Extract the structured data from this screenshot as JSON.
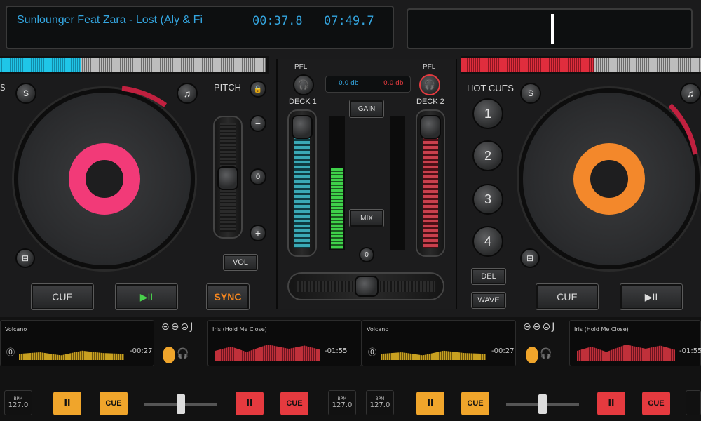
{
  "deckA": {
    "track_title": "Sunlounger Feat Zara - Lost (Aly & Fi",
    "elapsed": "00:37.8",
    "remaining": "07:49.7",
    "pitch_label": "PITCH",
    "s_label": "S",
    "pitch_minus": "−",
    "pitch_zero": "0",
    "pitch_plus": "+",
    "vol_label": "VOL",
    "cue_label": "CUE",
    "play_label": "▶II",
    "sync_label": "SYNC",
    "jog_color": "#f23a78"
  },
  "deckB": {
    "hot_cues_label": "HOT CUES",
    "s_label": "S",
    "hot_cues": [
      "1",
      "2",
      "3",
      "4"
    ],
    "del_label": "DEL",
    "wave_label": "WAVE",
    "cue_label": "CUE",
    "play_label": "▶II",
    "jog_color": "#f3882b"
  },
  "mixer": {
    "pfl_left": "PFL",
    "pfl_right": "PFL",
    "db_left": "0.0 db",
    "db_right": "0.0 db",
    "deck1_label": "DECK 1",
    "deck2_label": "DECK 2",
    "gain_label": "GAIN",
    "mix_label": "MIX",
    "zero_label": "0"
  },
  "bottom": {
    "panels": [
      {
        "track": "Volcano",
        "time": "-00:27"
      },
      {
        "track": "Iris (Hold Me Close)",
        "time": "-01:55"
      },
      {
        "track": "Volcano",
        "time": "-00:27"
      },
      {
        "track": "Iris (Hold Me Close)",
        "time": "-01:55"
      }
    ],
    "bpm_label": "BPM",
    "bpm_value": "127.0",
    "cue_label": "CUE",
    "pause_label": "II"
  },
  "colors": {
    "accent_blue": "#34a6e0",
    "meter_green": "#3fd14a",
    "fader_left": "#3aa9b5",
    "fader_right": "#c9404d",
    "sync_orange": "#f5861f",
    "play_green": "#48d14b"
  }
}
